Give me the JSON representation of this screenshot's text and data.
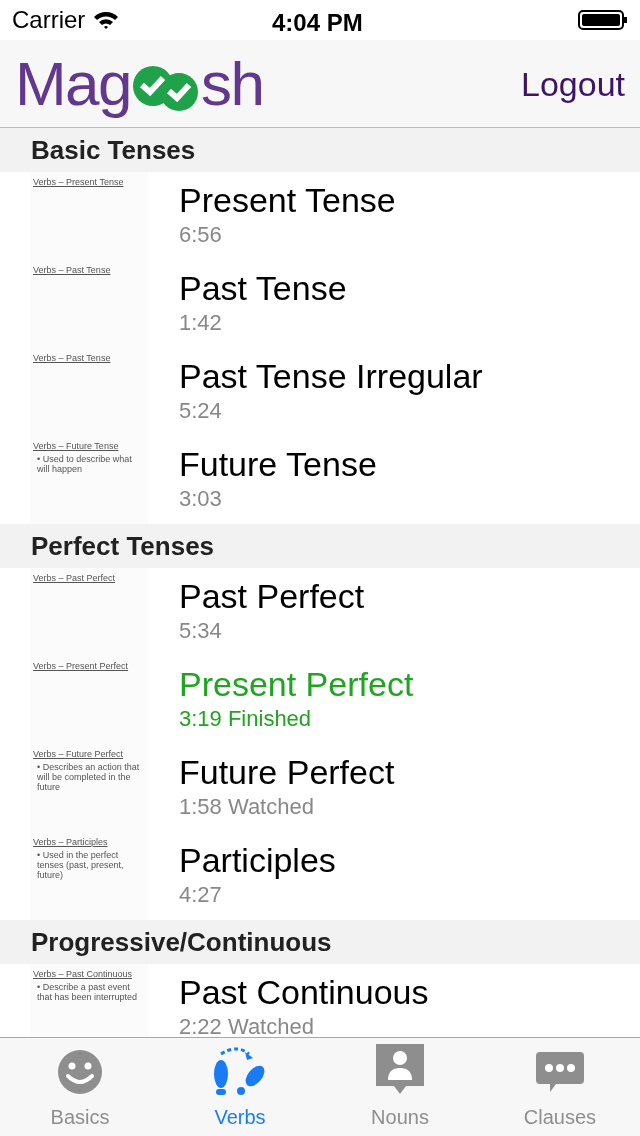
{
  "status_bar": {
    "carrier": "Carrier",
    "time": "4:04 PM"
  },
  "nav": {
    "logo": "Mag",
    "logo_end": "sh",
    "action": "Logout"
  },
  "sections": [
    {
      "title": "Basic Tenses",
      "lessons": [
        {
          "title": "Present Tense",
          "meta": "6:56",
          "finished": false,
          "thumb": {
            "title": "Verbs – Present Tense"
          }
        },
        {
          "title": "Past Tense",
          "meta": "1:42",
          "finished": false,
          "thumb": {
            "title": "Verbs – Past Tense"
          }
        },
        {
          "title": "Past Tense Irregular",
          "meta": "5:24",
          "finished": false,
          "thumb": {
            "title": "Verbs – Past Tense"
          }
        },
        {
          "title": "Future Tense",
          "meta": "3:03",
          "finished": false,
          "thumb": {
            "title": "Verbs – Future Tense",
            "bullet": "• Used to describe what will happen"
          }
        }
      ]
    },
    {
      "title": "Perfect Tenses",
      "lessons": [
        {
          "title": "Past Perfect",
          "meta": "5:34",
          "finished": false,
          "thumb": {
            "title": "Verbs – Past Perfect"
          }
        },
        {
          "title": "Present Perfect",
          "meta": "3:19 Finished",
          "finished": true,
          "thumb": {
            "title": "Verbs – Present Perfect"
          }
        },
        {
          "title": "Future Perfect",
          "meta": "1:58 Watched",
          "finished": false,
          "thumb": {
            "title": "Verbs – Future Perfect",
            "bullet": "• Describes an action that will be completed in the future"
          }
        },
        {
          "title": "Participles",
          "meta": "4:27",
          "finished": false,
          "thumb": {
            "title": "Verbs – Participles",
            "bullet": "• Used in the perfect tenses (past, present, future)"
          }
        }
      ]
    },
    {
      "title": "Progressive/Continuous",
      "lessons": [
        {
          "title": "Past Continuous",
          "meta": "2:22 Watched",
          "finished": false,
          "thumb": {
            "title": "Verbs – Past Continuous",
            "bullet": "• Describe a past event that has been interrupted"
          }
        }
      ]
    }
  ],
  "tabs": [
    {
      "label": "Basics",
      "kind": "smile",
      "selected": false
    },
    {
      "label": "Verbs",
      "kind": "steps",
      "selected": true
    },
    {
      "label": "Nouns",
      "kind": "person",
      "selected": false
    },
    {
      "label": "Clauses",
      "kind": "chat",
      "selected": false
    }
  ]
}
